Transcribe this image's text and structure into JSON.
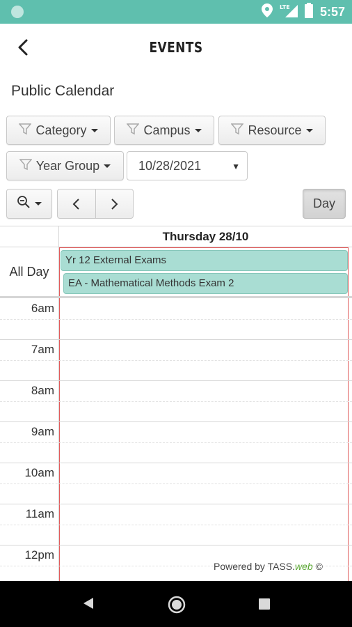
{
  "status_bar": {
    "time": "5:57",
    "network": "LTE"
  },
  "header": {
    "title": "EVENTS"
  },
  "page_title": "Public Calendar",
  "filters": {
    "category": "Category",
    "campus": "Campus",
    "resource": "Resource",
    "year_group": "Year Group"
  },
  "date_select": {
    "value": "10/28/2021"
  },
  "view_button": "Day",
  "calendar": {
    "day_header": "Thursday 28/10",
    "all_day_label": "All Day",
    "all_day_events": [
      "Yr 12 External Exams",
      "EA - Mathematical Methods Exam 2"
    ],
    "hours": [
      "6am",
      "7am",
      "8am",
      "9am",
      "10am",
      "11am",
      "12pm"
    ]
  },
  "footer": {
    "powered_prefix": "Powered by TASS.",
    "powered_web": "web",
    "copyright": "©"
  },
  "colors": {
    "status_bar": "#5fbfae",
    "event_bg": "#a9ddd3",
    "today_border": "#e05a5a"
  }
}
